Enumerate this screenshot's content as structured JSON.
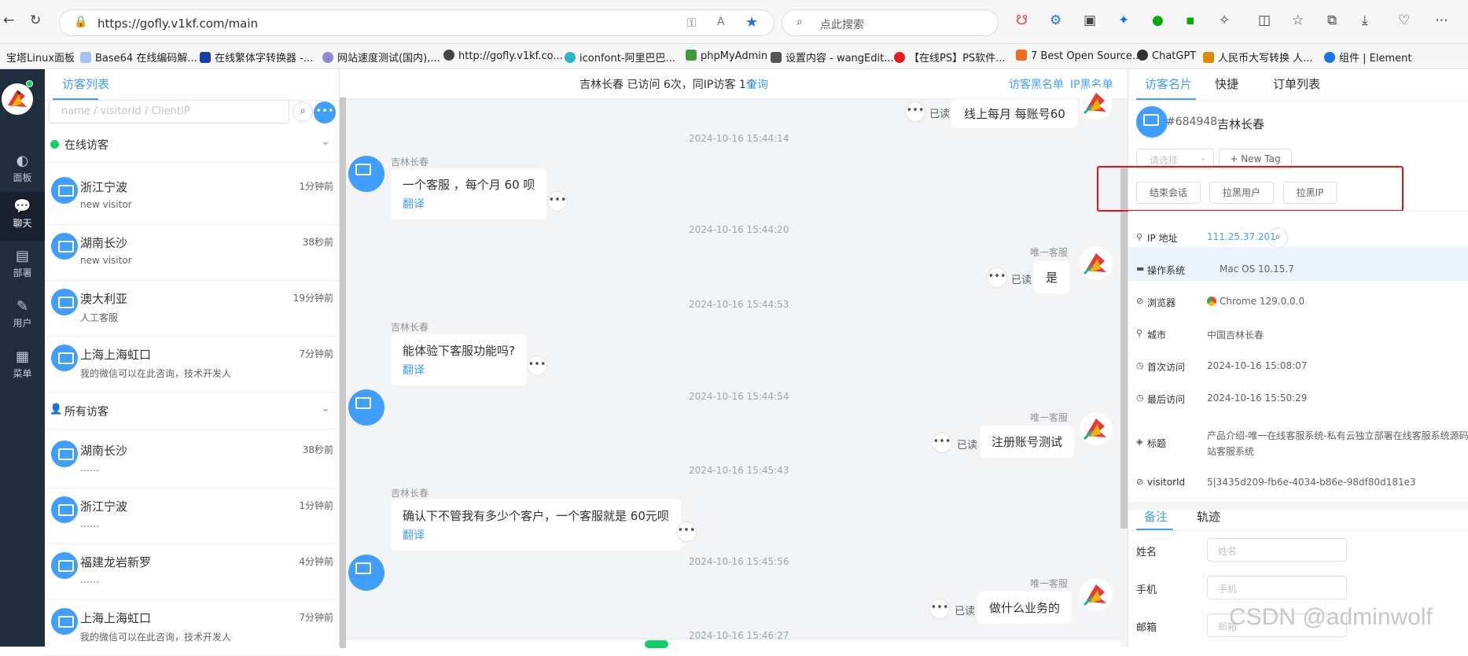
{
  "browser": {
    "url": "https://gofly.v1kf.com/main",
    "search_placeholder": "点此搜索",
    "bookmarks": [
      "宝塔Linux面板",
      "Base64 在线编码解...",
      "在线繁体字转换器 -...",
      "网站速度测试(国内),...",
      "http://gofly.v1kf.co...",
      "iconfont-阿里巴巴...",
      "phpMyAdmin",
      "设置内容 - wangEdit...",
      "【在线PS】PS软件...",
      "7 Best Open Source...",
      "ChatGPT",
      "人民币大写转换 人...",
      "组件 | Element"
    ]
  },
  "rail": {
    "items": [
      {
        "icon": "dashboard-icon",
        "label": "面板"
      },
      {
        "icon": "chat-icon",
        "label": "聊天"
      },
      {
        "icon": "deploy-icon",
        "label": "部署"
      },
      {
        "icon": "user-icon",
        "label": "用户"
      },
      {
        "icon": "menu-icon",
        "label": "菜单"
      }
    ]
  },
  "visitor_list": {
    "tab": "访客列表",
    "search_placeholder": "name / visitorId / ClientIP",
    "online_group": "在线访客",
    "all_group": "所有访客",
    "online": [
      {
        "name": "浙江宁波",
        "sub": "new visitor",
        "time": "1分钟前"
      },
      {
        "name": "湖南长沙",
        "sub": "new visitor",
        "time": "38秒前"
      },
      {
        "name": "澳大利亚",
        "sub": "人工客服",
        "time": "19分钟前"
      },
      {
        "name": "上海上海虹口",
        "sub": "我的微信可以在此咨询，技术开发人",
        "time": "7分钟前"
      }
    ],
    "all": [
      {
        "name": "湖南长沙",
        "sub": "……",
        "time": "38秒前"
      },
      {
        "name": "浙江宁波",
        "sub": "……",
        "time": "1分钟前"
      },
      {
        "name": "福建龙岩新罗",
        "sub": "……",
        "time": "4分钟前"
      },
      {
        "name": "上海上海虹口",
        "sub": "我的微信可以在此咨询，技术开发人",
        "time": "7分钟前"
      }
    ]
  },
  "chat": {
    "header_text": "吉林长春 已访问 6次，同IP访客 1个",
    "header_link": "查询",
    "blacklist_visitor": "访客黑名单",
    "blacklist_ip": "IP黑名单",
    "read_label": "已读",
    "translate_label": "翻译",
    "visitor_name": "吉林长春",
    "agent_name": "唯一客服",
    "top_agent_message": "线上每月 每账号60",
    "messages": [
      {
        "stamp": "2024-10-16 15:44:14",
        "text": "一个客服 ，每个月 60 呗"
      },
      {
        "stamp": "2024-10-16 15:44:20",
        "text": "是"
      },
      {
        "stamp": "2024-10-16 15:44:53",
        "text": "能体验下客服功能吗?"
      },
      {
        "stamp": "2024-10-16 15:44:54",
        "text": "注册账号测试"
      },
      {
        "stamp": "2024-10-16 15:45:43",
        "text": "确认下不管我有多少个客户，一个客服就是 60元呗"
      },
      {
        "stamp": "2024-10-16 15:45:56",
        "text": "做什么业务的"
      },
      {
        "stamp": "2024-10-16 15:46:27",
        "text": ""
      }
    ]
  },
  "card": {
    "tabs": [
      "访客名片",
      "快捷",
      "订单列表"
    ],
    "visitor_id": "#684948",
    "visitor_name": "吉林长春",
    "select_placeholder": "请选择",
    "new_tag": "+ New Tag",
    "actions": [
      "结束会话",
      "拉黑用户",
      "拉黑IP"
    ],
    "highlight_color": "#e0141e",
    "fields": [
      {
        "label": "IP 地址",
        "value": "111.25.37.201"
      },
      {
        "label": "操作系统",
        "value": "Mac OS 10.15.7"
      },
      {
        "label": "浏览器",
        "value": "Chrome 129.0.0.0"
      },
      {
        "label": "城市",
        "value": "中国吉林长春"
      },
      {
        "label": "首次访问",
        "value": "2024-10-16 15:08:07"
      },
      {
        "label": "最后访问",
        "value": "2024-10-16 15:50:29"
      },
      {
        "label": "标题",
        "value": "产品介绍-唯一在线客服系统-私有云独立部署在线客服系统源码"
      },
      {
        "label": "visitorId",
        "value": "5|3435d209-fb6e-4034-b86e-98df80d181e3"
      }
    ],
    "title_line2": "站客服系统",
    "note_tabs": [
      "备注",
      "轨迹"
    ],
    "note_fields": [
      {
        "label": "姓名",
        "placeholder": "姓名"
      },
      {
        "label": "手机",
        "placeholder": "手机"
      },
      {
        "label": "邮箱",
        "placeholder": "邮箱"
      }
    ]
  },
  "watermark": "CSDN @adminwolf",
  "colors": {
    "accent": "#409eff",
    "rail": "#1f2d3d",
    "online": "#13ce66"
  }
}
